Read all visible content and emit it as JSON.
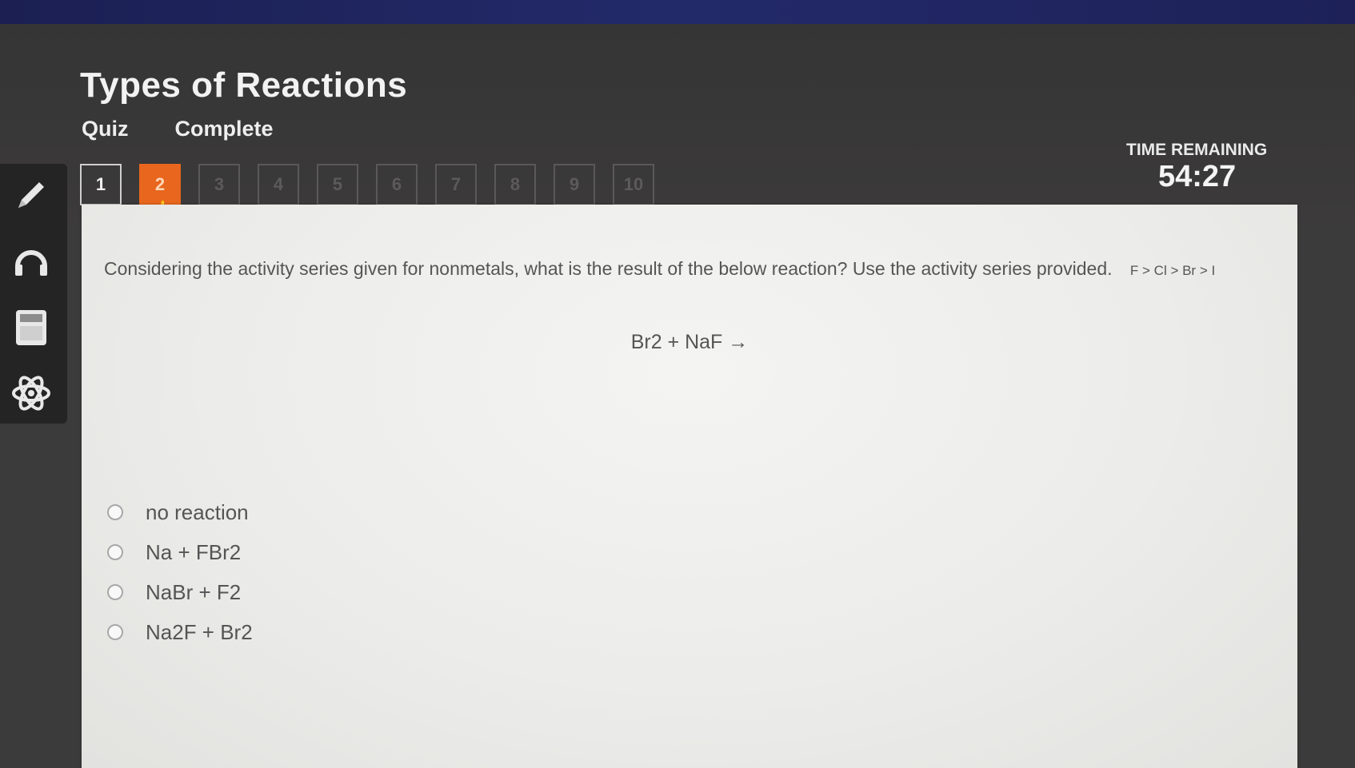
{
  "quiz": {
    "title": "Types of Reactions",
    "type_label": "Quiz",
    "status_label": "Complete"
  },
  "navigation": {
    "questions": [
      "1",
      "2",
      "3",
      "4",
      "5",
      "6",
      "7",
      "8",
      "9",
      "10"
    ],
    "current": "2"
  },
  "timer": {
    "label": "TIME REMAINING",
    "value": "54:27"
  },
  "sidebar": {
    "icons": [
      "pencil-icon",
      "headphones-icon",
      "calculator-icon",
      "atom-icon"
    ]
  },
  "question": {
    "text": "Considering the activity series given for nonmetals, what is the result of the below reaction? Use the activity series provided.",
    "series": "F > Cl > Br > I",
    "equation": "Br2 + NaF →"
  },
  "options": [
    {
      "label": "no reaction"
    },
    {
      "label": "Na + FBr2"
    },
    {
      "label": "NaBr + F2"
    },
    {
      "label": "Na2F + Br2"
    }
  ],
  "colors": {
    "accent": "#e8661d",
    "header_bg": "#363636",
    "panel_bg": "#efefed",
    "topbar": "#1f2460"
  }
}
